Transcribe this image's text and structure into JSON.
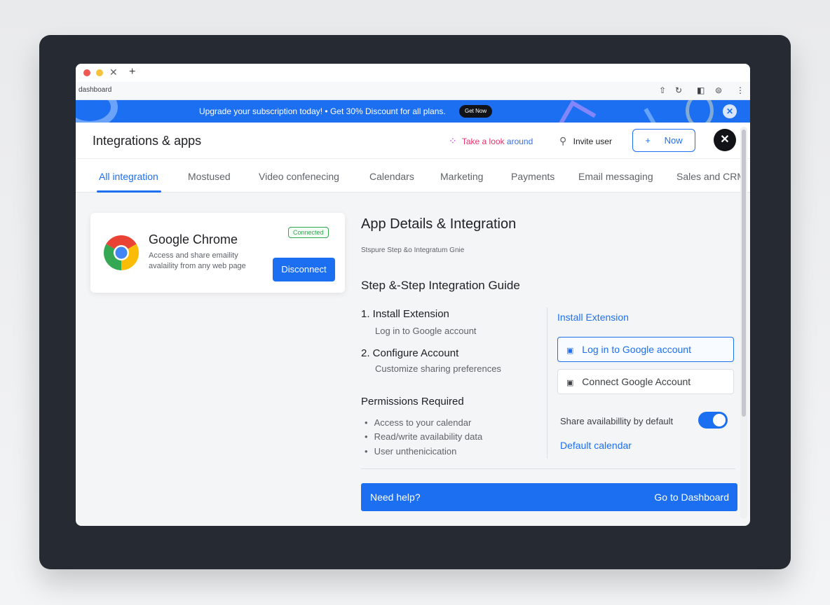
{
  "browser": {
    "url": "dashboard",
    "icons": [
      "share-icon",
      "refresh-icon",
      "sidebar-icon",
      "extensions-icon",
      "menu-icon"
    ]
  },
  "banner": {
    "text": "Upgrade your subscription today! • Get 30% Discount for all plans.",
    "button": "Get Now"
  },
  "header": {
    "title": "Integrations & apps",
    "tour_part1": "Take a look",
    "tour_part2": "around",
    "invite": "Invite user",
    "new_button": "Now"
  },
  "tabs": [
    "All integration",
    "Mostused",
    "Video confenecing",
    "Calendars",
    "Marketing",
    "Payments",
    "Email messaging",
    "Sales and CRM"
  ],
  "app_card": {
    "name": "Google Chrome",
    "description": "Access and share emaility avalaility from any web page",
    "status": "Connected",
    "disconnect": "Disconnect"
  },
  "details": {
    "title": "App Details & Integration",
    "subtitle": "Stspure Step &o Integratum Gnie",
    "guide_title": "Step &-Step Integration Guide",
    "steps": [
      {
        "title": "1. Install Extension",
        "desc": "Log in to Google account"
      },
      {
        "title": "2. Configure Account",
        "desc": "Customize sharing preferences"
      }
    ],
    "permissions_title": "Permissions Required",
    "permissions": [
      "Access to your calendar",
      "Read/write availability data",
      "User unthenicication"
    ]
  },
  "side_panel": {
    "install_link": "Install Extension",
    "login_button": "Log in to Google account",
    "connect_button": "Connect Google Account",
    "toggle_label": "Share availabillity by default",
    "toggle_on": true,
    "default_calendar": "Default calendar"
  },
  "help_bar": {
    "text": "Need help?",
    "link": "Go to Dashboard"
  },
  "colors": {
    "accent": "#1d6ff2",
    "connected": "#34a853",
    "frame": "#252a33"
  }
}
